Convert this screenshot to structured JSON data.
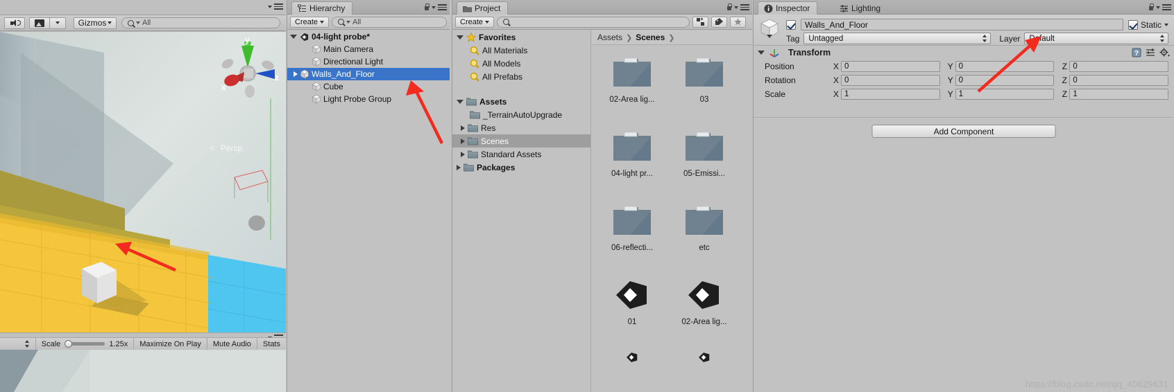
{
  "scene_view": {
    "toolbar": {
      "audio_icon": "speaker-icon",
      "image_icon": "picture-icon",
      "gizmos_label": "Gizmos",
      "search_placeholder": "All",
      "search_value": "All"
    },
    "gizmo_axes": {
      "x": "x",
      "y": "y",
      "z": "z"
    },
    "persp_label": "Persp"
  },
  "game_toolbar": {
    "scale_label": "Scale",
    "scale_value": "1.25x",
    "maximize_label": "Maximize On Play",
    "mute_label": "Mute Audio",
    "stats_label": "Stats"
  },
  "hierarchy": {
    "tab_label": "Hierarchy",
    "create_label": "Create",
    "search_value": "All",
    "scene_name": "04-light probe*",
    "items": [
      {
        "label": "Main Camera",
        "icon": "cube-icon",
        "expandable": false,
        "selected": false
      },
      {
        "label": "Directional Light",
        "icon": "cube-icon",
        "expandable": false,
        "selected": false
      },
      {
        "label": "Walls_And_Floor",
        "icon": "cube-icon",
        "expandable": true,
        "selected": true
      },
      {
        "label": "Cube",
        "icon": "cube-icon",
        "expandable": false,
        "selected": false
      },
      {
        "label": "Light Probe Group",
        "icon": "cube-icon",
        "expandable": false,
        "selected": false
      }
    ]
  },
  "project": {
    "tab_label": "Project",
    "create_label": "Create",
    "search_value": "",
    "tree": [
      {
        "label": "Favorites",
        "icon": "star-icon",
        "indent": 0,
        "arrow": "open",
        "bold": true,
        "selected": false
      },
      {
        "label": "All Materials",
        "icon": "search-icon",
        "indent": 1,
        "arrow": "none",
        "bold": false,
        "selected": false
      },
      {
        "label": "All Models",
        "icon": "search-icon",
        "indent": 1,
        "arrow": "none",
        "bold": false,
        "selected": false
      },
      {
        "label": "All Prefabs",
        "icon": "search-icon",
        "indent": 1,
        "arrow": "none",
        "bold": false,
        "selected": false
      },
      {
        "label": "",
        "icon": "none",
        "indent": 0,
        "arrow": "none",
        "bold": false,
        "selected": false
      },
      {
        "label": "Assets",
        "icon": "folder-icon",
        "indent": 0,
        "arrow": "open",
        "bold": true,
        "selected": false
      },
      {
        "label": "_TerrainAutoUpgrade",
        "icon": "folder-icon",
        "indent": 1,
        "arrow": "none",
        "bold": false,
        "selected": false
      },
      {
        "label": "Res",
        "icon": "folder-icon",
        "indent": 1,
        "arrow": "closed",
        "bold": false,
        "selected": false
      },
      {
        "label": "Scenes",
        "icon": "folder-icon",
        "indent": 1,
        "arrow": "closed",
        "bold": false,
        "selected": true
      },
      {
        "label": "Standard Assets",
        "icon": "folder-icon",
        "indent": 1,
        "arrow": "closed",
        "bold": false,
        "selected": false
      },
      {
        "label": "Packages",
        "icon": "folder-icon",
        "indent": 0,
        "arrow": "closed",
        "bold": true,
        "selected": false
      }
    ],
    "breadcrumb": [
      "Assets",
      "Scenes"
    ],
    "grid": [
      {
        "label": "02-Area lig...",
        "icon": "folder-thumb"
      },
      {
        "label": "03",
        "icon": "folder-thumb"
      },
      {
        "label": "04-light pr...",
        "icon": "folder-thumb"
      },
      {
        "label": "05-Emissi...",
        "icon": "folder-thumb"
      },
      {
        "label": "06-reflecti...",
        "icon": "folder-thumb"
      },
      {
        "label": "etc",
        "icon": "folder-thumb"
      },
      {
        "label": "01",
        "icon": "unity-scene-thumb"
      },
      {
        "label": "02-Area lig...",
        "icon": "unity-scene-thumb"
      }
    ]
  },
  "inspector": {
    "tab_label": "Inspector",
    "lighting_tab_label": "Lighting",
    "object_name": "Walls_And_Floor",
    "enabled": true,
    "static_label": "Static",
    "static_checked": true,
    "tag_label": "Tag",
    "tag_value": "Untagged",
    "layer_label": "Layer",
    "layer_value": "Default",
    "component_title": "Transform",
    "transform": [
      {
        "name": "Position",
        "x": "0",
        "y": "0",
        "z": "0"
      },
      {
        "name": "Rotation",
        "x": "0",
        "y": "0",
        "z": "0"
      },
      {
        "name": "Scale",
        "x": "1",
        "y": "1",
        "z": "1"
      }
    ],
    "axis_labels": {
      "x": "X",
      "y": "Y",
      "z": "Z"
    },
    "add_component_label": "Add Component"
  },
  "watermark": "https://blog.csdn.net/qq_40629631",
  "colors": {
    "selection_blue": "#3a74c8",
    "tree_selection_gray": "#9e9e9e",
    "annotation_red": "#f22b1e",
    "panel_bg": "#c2c2c2",
    "floor_yellow": "#f5c63c",
    "floor_blue": "#4fc6f0"
  }
}
